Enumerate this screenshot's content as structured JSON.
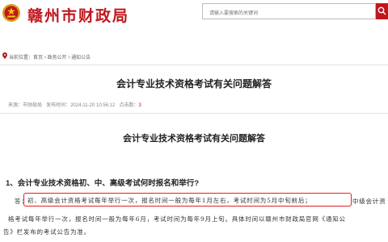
{
  "header": {
    "site_title": "赣州市财政局",
    "search_placeholder": "请输入要搜索的关键词"
  },
  "breadcrumb": {
    "label": "当前位置：",
    "items": [
      "首页",
      "政务公开",
      "通知公告"
    ],
    "separator": ">"
  },
  "article": {
    "title": "会计专业技术资格考试有关问题解答",
    "meta": {
      "source_label": "来源：",
      "source": "市财政局",
      "date_label": "发布时间：",
      "date": "2024-11-20 10:56:12",
      "hits_label": "点击数：",
      "hits": "3"
    },
    "subtitle": "会计专业技术资格考试有关问题解答",
    "question_1": "1、会计专业技术资格初、中、高级考试何时报名和举行?",
    "para_lead": "答：",
    "para_highlight": "初、高级会计资格考试每年举行一次，报名时间一般为每年1月左右，考试时间为5月中旬前后；",
    "para_tail": "中级会计资",
    "para_line2": "格考试每年举行一次，报名时间一般为每年6月，考试时间为每年9月上旬。具体时间以赣州市财政局官网《通知公",
    "para_line3": "告》栏发布的考试公告为准。"
  },
  "colors": {
    "brand_red": "#c0161d",
    "highlight_border": "#e02020"
  },
  "icons": {
    "emblem": "national-emblem-icon",
    "search": "search-icon",
    "location": "location-pin-icon"
  }
}
